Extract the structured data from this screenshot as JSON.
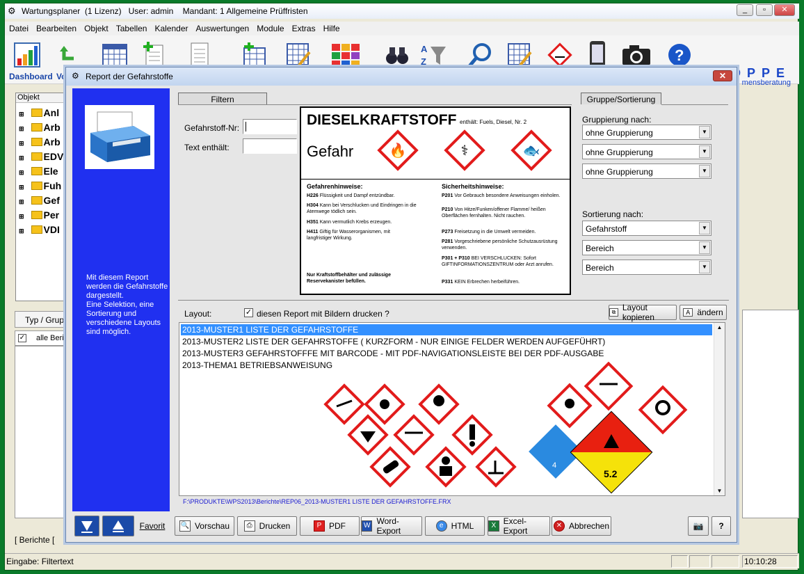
{
  "window": {
    "title": "Wartungsplaner  (1 Lizenz)   User: admin    Mandant: 1 Allgemeine Prüffristen"
  },
  "menu": [
    "Datei",
    "Bearbeiten",
    "Objekt",
    "Tabellen",
    "Kalender",
    "Auswertungen",
    "Module",
    "Extras",
    "Hilfe"
  ],
  "toolbar": {
    "dashboard_label": "Dashboard",
    "vo_label": "Vo"
  },
  "brand": {
    "name": "HOPPE",
    "sub": "mensberatung"
  },
  "tree": {
    "header": "Objekt",
    "items": [
      "Anl",
      "Arb",
      "Arb",
      "EDV",
      "Ele",
      "Fuh",
      "Gef",
      "Per",
      "VDI"
    ]
  },
  "left_pane": {
    "tab_label": "Typ / Grup",
    "row_label": "alle Beric",
    "bottom_tab": "[ Berichte ["
  },
  "dialog": {
    "title": "Report der Gefahrstoffe",
    "close_label": "✕",
    "side_text": "Mit diesem Report\nwerden die Gefahrstoffe\ndargestellt.\nEine Selektion, eine\nSortierung und\nverschiedene Layouts\nsind möglich.",
    "filter_tab": "Filtern",
    "gruppe_tab": "Gruppe/Sortierung",
    "filter_fields": [
      {
        "label": "Gefahrstoff-Nr:",
        "value": ""
      },
      {
        "label": "Text enthält:",
        "value": ""
      }
    ],
    "label_preview": {
      "product": "DIESELKRAFTSTOFF",
      "contains": "enthält: Fuels, Diesel, Nr. 2",
      "signal_word": "Gefahr",
      "hazard_header": "Gefahrenhinweise:",
      "safety_header": "Sicherheitshinweise:",
      "hazards": [
        {
          "code": "H226",
          "text": "Flüssigkeit und Dampf entzündbar."
        },
        {
          "code": "H304",
          "text": "Kann bei Verschlucken und Eindringen in die Atemwege tödlich sein."
        },
        {
          "code": "H351",
          "text": "Kann vermutlich Krebs erzeugen."
        },
        {
          "code": "H411",
          "text": "Giftig für Wasserorganismen, mit langfristiger Wirkung."
        }
      ],
      "safety": [
        {
          "code": "P201",
          "text": "Vor Gebrauch besondere Anweisungen einholen."
        },
        {
          "code": "P210",
          "text": "Von Hitze/Funken/offener Flamme/ heißen Oberflächen fernhalten. Nicht rauchen."
        },
        {
          "code": "P273",
          "text": "Freisetzung in die Umwelt vermeiden."
        },
        {
          "code": "P281",
          "text": "Vorgeschriebene persönliche Schutzausrüstung verwenden."
        },
        {
          "code": "P301 + P310",
          "text": "BEI VERSCHLUCKEN: Sofort GIFTINFORMATIONSZENTRUM oder Arzt anrufen."
        },
        {
          "code": "P331",
          "text": "KEIN Erbrechen herbeiführen."
        }
      ],
      "footer": "Nur Kraftstoffbehälter und zulässige Reservekanister befüllen."
    },
    "grouping_label": "Gruppierung nach:",
    "grouping": [
      "ohne Gruppierung",
      "ohne Gruppierung",
      "ohne Gruppierung"
    ],
    "sorting_label": "Sortierung nach:",
    "sorting": [
      "Gefahrstoff",
      "Bereich",
      "Bereich"
    ],
    "layout_label": "Layout:",
    "print_images_label": "diesen Report mit Bildern drucken ?",
    "print_images_checked": true,
    "copy_layout_btn": "Layout kopieren",
    "change_btn": "ändern",
    "layouts": [
      "2013-MUSTER1 LISTE DER GEFAHRSTOFFE",
      "2013-MUSTER2 LISTE DER GEFAHRSTOFFE ( KURZFORM - NUR EINIGE FELDER WERDEN AUFGEFÜHRT)",
      "2013-MUSTER3 GEFAHRSTOFFFE MIT BARCODE - MIT PDF-NAVIGATIONSLEISTE BEI DER PDF-AUSGABE",
      "2013-THEMA1 BETRIEBSANWEISUNG"
    ],
    "selected_layout": 0,
    "file_path": "F:\\PRODUKTE\\WPS2013\\Berichte\\REP06_2013-MUSTER1 LISTE DER GEFAHRSTOFFE.FRX",
    "adr_numbers": [
      "4",
      "5.2"
    ],
    "buttons": {
      "favorit": "Favorit",
      "preview": "Vorschau",
      "print": "Drucken",
      "pdf": "PDF",
      "word": "Word-Export",
      "html": "HTML",
      "excel": "Excel-Export",
      "cancel": "Abbrechen"
    }
  },
  "status": {
    "text": "Eingabe: Filtertext",
    "time": "10:10:28"
  },
  "colors": {
    "accent": "#2030f0",
    "selection": "#3390ff",
    "hazard_red": "#e21b1b"
  }
}
